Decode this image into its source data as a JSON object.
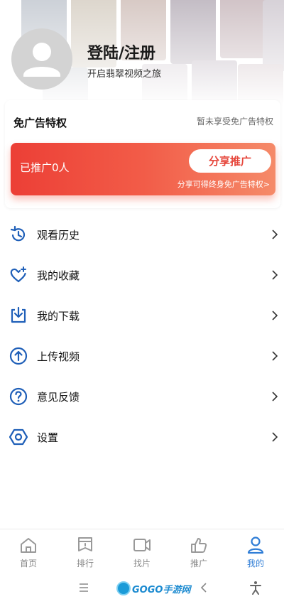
{
  "profile": {
    "title": "登陆/注册",
    "subtitle": "开启翡翠视频之旅"
  },
  "ad_free": {
    "title": "免广告特权",
    "status": "暂未享受免广告特权",
    "promo_count": "已推广0人",
    "share_button": "分享推广",
    "note": "分享可得终身免广告特权>"
  },
  "menu": {
    "items": [
      {
        "label": "观看历史",
        "icon": "history-icon"
      },
      {
        "label": "我的收藏",
        "icon": "heart-plus-icon"
      },
      {
        "label": "我的下载",
        "icon": "download-icon"
      },
      {
        "label": "上传视频",
        "icon": "upload-icon"
      },
      {
        "label": "意见反馈",
        "icon": "question-icon"
      },
      {
        "label": "设置",
        "icon": "settings-icon"
      }
    ]
  },
  "bottom_nav": {
    "items": [
      {
        "label": "首页",
        "icon": "home-icon",
        "active": false
      },
      {
        "label": "排行",
        "icon": "ranking-icon",
        "active": false
      },
      {
        "label": "找片",
        "icon": "video-camera-icon",
        "active": false
      },
      {
        "label": "推广",
        "icon": "thumb-up-icon",
        "active": false
      },
      {
        "label": "我的",
        "icon": "user-icon",
        "active": true
      }
    ]
  },
  "system_bar": {
    "watermark": "GOGO手游网"
  },
  "colors": {
    "accent_blue": "#2f7dd6",
    "promo_red": "#ec3f36",
    "promo_orange": "#f58a69",
    "icon_blue": "#1f5fb8"
  }
}
